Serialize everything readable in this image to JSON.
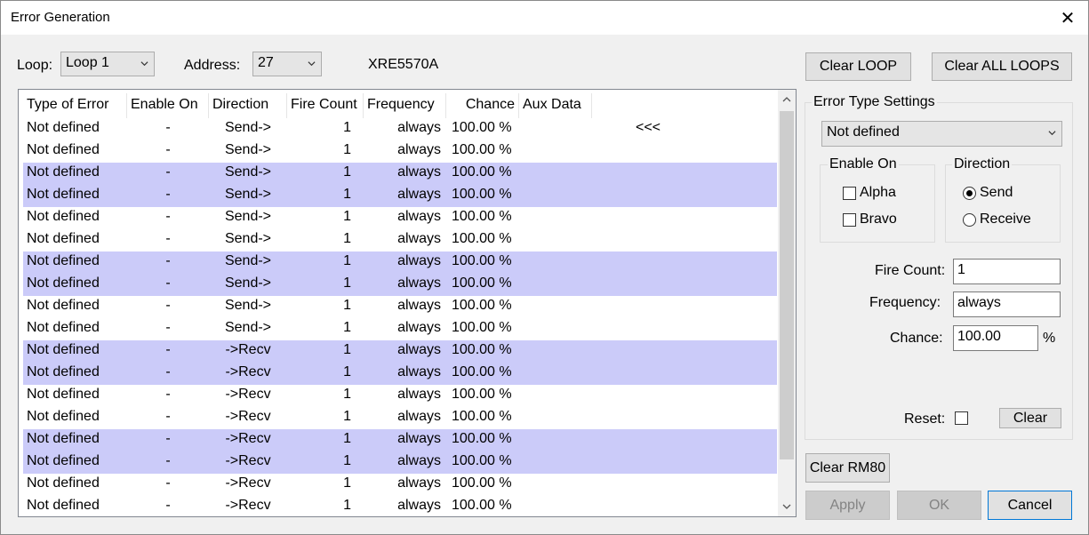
{
  "window": {
    "title": "Error Generation",
    "close_glyph": "✕"
  },
  "top": {
    "loop_label": "Loop:",
    "loop_value": "Loop 1",
    "address_label": "Address:",
    "address_value": "27",
    "device_name": "XRE5570A"
  },
  "buttons": {
    "clear_loop": "Clear LOOP",
    "clear_all_loops": "Clear ALL LOOPS",
    "clear_rm80": "Clear RM80",
    "apply": "Apply",
    "ok": "OK",
    "cancel": "Cancel",
    "clear": "Clear"
  },
  "table": {
    "columns": [
      "Type of Error",
      "Enable On",
      "Direction",
      "Fire Count",
      "Frequency",
      "Chance",
      "Aux Data"
    ],
    "rows": [
      {
        "type": "Not defined",
        "enable": "-",
        "direction": "Send->",
        "fire": "1",
        "freq": "always",
        "chance": "100.00 %",
        "aux": "<<<",
        "selected": false
      },
      {
        "type": "Not defined",
        "enable": "-",
        "direction": "Send->",
        "fire": "1",
        "freq": "always",
        "chance": "100.00 %",
        "aux": "",
        "selected": false
      },
      {
        "type": "Not defined",
        "enable": "-",
        "direction": "Send->",
        "fire": "1",
        "freq": "always",
        "chance": "100.00 %",
        "aux": "",
        "selected": true
      },
      {
        "type": "Not defined",
        "enable": "-",
        "direction": "Send->",
        "fire": "1",
        "freq": "always",
        "chance": "100.00 %",
        "aux": "",
        "selected": true
      },
      {
        "type": "Not defined",
        "enable": "-",
        "direction": "Send->",
        "fire": "1",
        "freq": "always",
        "chance": "100.00 %",
        "aux": "",
        "selected": false
      },
      {
        "type": "Not defined",
        "enable": "-",
        "direction": "Send->",
        "fire": "1",
        "freq": "always",
        "chance": "100.00 %",
        "aux": "",
        "selected": false
      },
      {
        "type": "Not defined",
        "enable": "-",
        "direction": "Send->",
        "fire": "1",
        "freq": "always",
        "chance": "100.00 %",
        "aux": "",
        "selected": true
      },
      {
        "type": "Not defined",
        "enable": "-",
        "direction": "Send->",
        "fire": "1",
        "freq": "always",
        "chance": "100.00 %",
        "aux": "",
        "selected": true
      },
      {
        "type": "Not defined",
        "enable": "-",
        "direction": "Send->",
        "fire": "1",
        "freq": "always",
        "chance": "100.00 %",
        "aux": "",
        "selected": false
      },
      {
        "type": "Not defined",
        "enable": "-",
        "direction": "Send->",
        "fire": "1",
        "freq": "always",
        "chance": "100.00 %",
        "aux": "",
        "selected": false
      },
      {
        "type": "Not defined",
        "enable": "-",
        "direction": "->Recv",
        "fire": "1",
        "freq": "always",
        "chance": "100.00 %",
        "aux": "",
        "selected": true
      },
      {
        "type": "Not defined",
        "enable": "-",
        "direction": "->Recv",
        "fire": "1",
        "freq": "always",
        "chance": "100.00 %",
        "aux": "",
        "selected": true
      },
      {
        "type": "Not defined",
        "enable": "-",
        "direction": "->Recv",
        "fire": "1",
        "freq": "always",
        "chance": "100.00 %",
        "aux": "",
        "selected": false
      },
      {
        "type": "Not defined",
        "enable": "-",
        "direction": "->Recv",
        "fire": "1",
        "freq": "always",
        "chance": "100.00 %",
        "aux": "",
        "selected": false
      },
      {
        "type": "Not defined",
        "enable": "-",
        "direction": "->Recv",
        "fire": "1",
        "freq": "always",
        "chance": "100.00 %",
        "aux": "",
        "selected": true
      },
      {
        "type": "Not defined",
        "enable": "-",
        "direction": "->Recv",
        "fire": "1",
        "freq": "always",
        "chance": "100.00 %",
        "aux": "",
        "selected": true
      },
      {
        "type": "Not defined",
        "enable": "-",
        "direction": "->Recv",
        "fire": "1",
        "freq": "always",
        "chance": "100.00 %",
        "aux": "",
        "selected": false
      },
      {
        "type": "Not defined",
        "enable": "-",
        "direction": "->Recv",
        "fire": "1",
        "freq": "always",
        "chance": "100.00 %",
        "aux": "",
        "selected": false
      }
    ]
  },
  "settings": {
    "group_title": "Error Type Settings",
    "error_type_value": "Not defined",
    "enable_on": {
      "title": "Enable On",
      "alpha_label": "Alpha",
      "alpha_checked": false,
      "bravo_label": "Bravo",
      "bravo_checked": false
    },
    "direction": {
      "title": "Direction",
      "send_label": "Send",
      "receive_label": "Receive",
      "selected": "Send"
    },
    "fire_count_label": "Fire Count:",
    "fire_count_value": "1",
    "frequency_label": "Frequency:",
    "frequency_value": "always",
    "chance_label": "Chance:",
    "chance_value": "100.00",
    "chance_unit": "%",
    "reset_label": "Reset:",
    "reset_checked": false
  },
  "colors": {
    "selected_row": "#cbcbf9",
    "dialog_bg": "#f0f0f0"
  }
}
